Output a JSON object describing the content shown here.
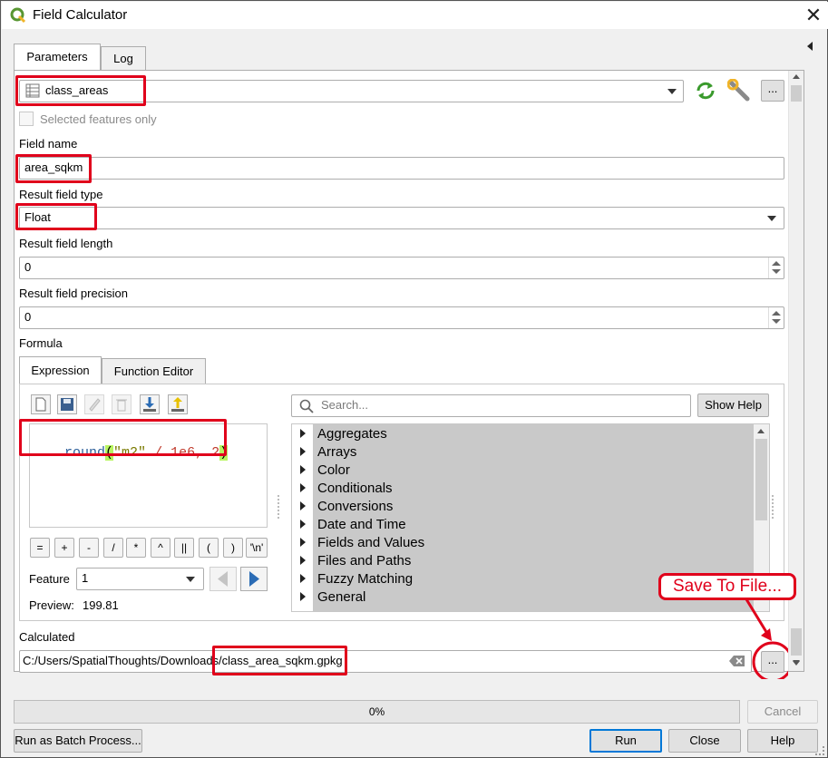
{
  "window": {
    "title": "Field Calculator"
  },
  "tabs": {
    "parameters": "Parameters",
    "log": "Log"
  },
  "input_layer": {
    "value": "class_areas"
  },
  "selected_only": {
    "label": "Selected features only",
    "checked": false
  },
  "field_name": {
    "label": "Field name",
    "value": "area_sqkm"
  },
  "result_type": {
    "label": "Result field type",
    "value": "Float"
  },
  "result_length": {
    "label": "Result field length",
    "value": "0"
  },
  "result_precision": {
    "label": "Result field precision",
    "value": "0"
  },
  "formula": {
    "label": "Formula",
    "tabs": {
      "expression": "Expression",
      "function_editor": "Function Editor"
    },
    "expr": {
      "fn": "round",
      "open": "(",
      "str": "\"m2\"",
      "op": " / 1e6, 2",
      "close": ")"
    },
    "operators": [
      "=",
      "+",
      "-",
      "/",
      "*",
      "^",
      "||",
      "(",
      ")",
      "'\\n'"
    ],
    "feature_label": "Feature",
    "feature_value": "1",
    "preview_label": "Preview:",
    "preview_value": "199.81",
    "search_placeholder": "Search...",
    "show_help": "Show Help",
    "functions": [
      "Aggregates",
      "Arrays",
      "Color",
      "Conditionals",
      "Conversions",
      "Date and Time",
      "Fields and Values",
      "Files and Paths",
      "Fuzzy Matching",
      "General"
    ]
  },
  "calculated": {
    "label": "Calculated",
    "path_prefix": "C:/Users/SpatialThoughts/Downloads/",
    "path_file": "class_area_sqkm.gpkg",
    "browse": "..."
  },
  "annotation": {
    "text": "Save To File..."
  },
  "progress": {
    "value": "0%"
  },
  "buttons": {
    "cancel": "Cancel",
    "batch": "Run as Batch Process...",
    "run": "Run",
    "close": "Close",
    "help": "Help",
    "more": "..."
  },
  "colors": {
    "red_annotation": "#e0001b",
    "tree_bg": "#c9c9c9",
    "code_fn": "#2d5f9a",
    "code_str": "#7a7a00",
    "code_num": "#c0392b",
    "bracket_hl": "#b8f560"
  }
}
